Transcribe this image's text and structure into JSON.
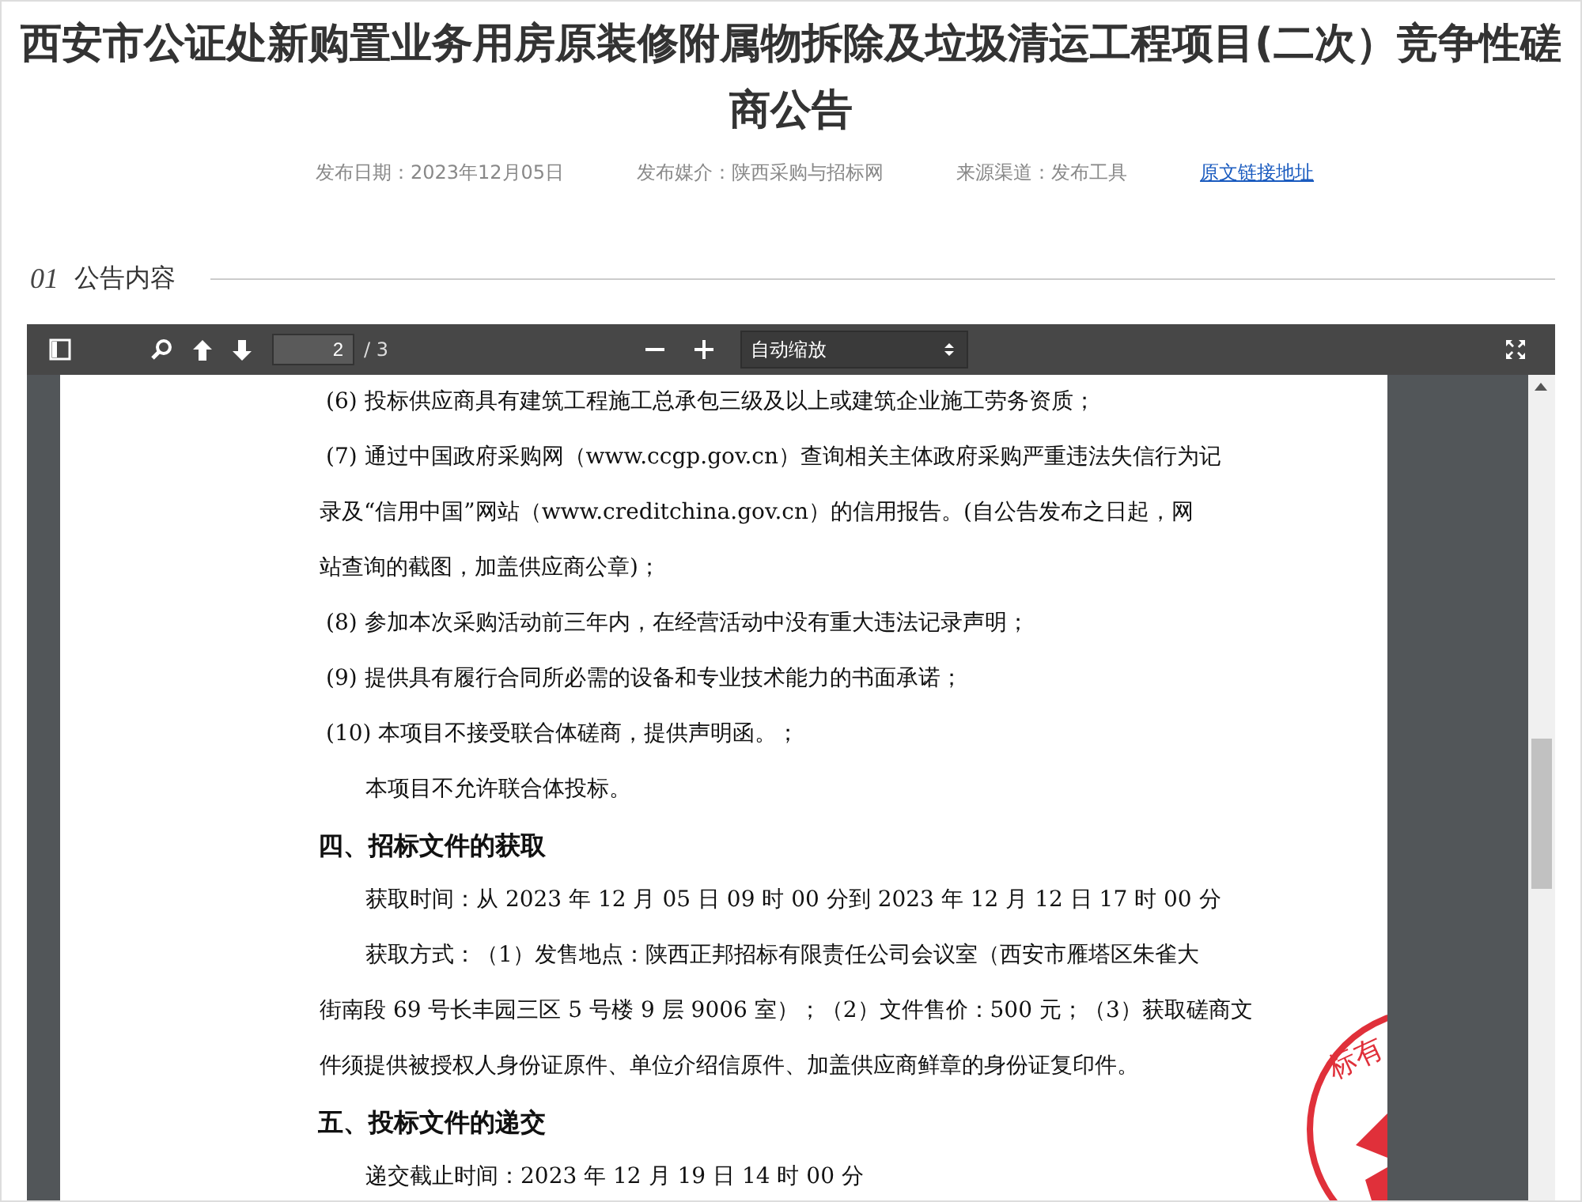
{
  "title": "西安市公证处新购置业务用房原装修附属物拆除及垃圾清运工程项目(二次）竞争性磋商公告",
  "meta": [
    {
      "kind": "text",
      "text": "发布日期：2023年12月05日"
    },
    {
      "kind": "text",
      "text": "发布媒介：陕西采购与招标网"
    },
    {
      "kind": "text",
      "text": "来源渠道：发布工具"
    },
    {
      "kind": "link",
      "text": "原文链接地址"
    }
  ],
  "section": {
    "number": "01",
    "label": "公告内容"
  },
  "viewer": {
    "toolbar": {
      "page_number": "2",
      "page_count": "/ 3",
      "zoom_select": "自动缩放"
    },
    "lines": [
      {
        "kind": "item",
        "text": "(6) 投标供应商具有建筑工程施工总承包三级及以上或建筑企业施工劳务资质；"
      },
      {
        "kind": "item",
        "text": "(7) 通过中国政府采购网（www.ccgp.gov.cn）查询相关主体政府采购严重违法失信行为记"
      },
      {
        "kind": "cont",
        "text": "录及“信用中国”网站（www.creditchina.gov.cn）的信用报告。(自公告发布之日起，网"
      },
      {
        "kind": "cont",
        "text": "站查询的截图，加盖供应商公章)；"
      },
      {
        "kind": "item",
        "text": "(8) 参加本次采购活动前三年内，在经营活动中没有重大违法记录声明；"
      },
      {
        "kind": "item",
        "text": "(9) 提供具有履行合同所必需的设备和专业技术能力的书面承诺；"
      },
      {
        "kind": "item",
        "text": "(10) 本项目不接受联合体磋商，提供声明函。；"
      },
      {
        "kind": "indent",
        "text": "本项目不允许联合体投标。"
      },
      {
        "kind": "heading",
        "text": "四、招标文件的获取"
      },
      {
        "kind": "indent",
        "text": "获取时间：从 2023 年 12 月 05 日 09 时 00 分到 2023 年 12 月 12 日 17 时 00 分"
      },
      {
        "kind": "indent",
        "text": "获取方式：（1）发售地点：陕西正邦招标有限责任公司会议室（西安市雁塔区朱雀大"
      },
      {
        "kind": "cont",
        "text": "街南段 69 号长丰园三区 5 号楼 9 层 9006 室）；（2）文件售价：500 元；（3）获取磋商文"
      },
      {
        "kind": "cont",
        "text": "件须提供被授权人身份证原件、单位介绍信原件、加盖供应商鲜章的身份证复印件。"
      },
      {
        "kind": "heading",
        "text": "五、投标文件的递交"
      },
      {
        "kind": "indent",
        "text": "递交截止时间：2023 年 12 月 19 日 14 时 00 分"
      }
    ],
    "seal": {
      "text": "标有"
    }
  }
}
